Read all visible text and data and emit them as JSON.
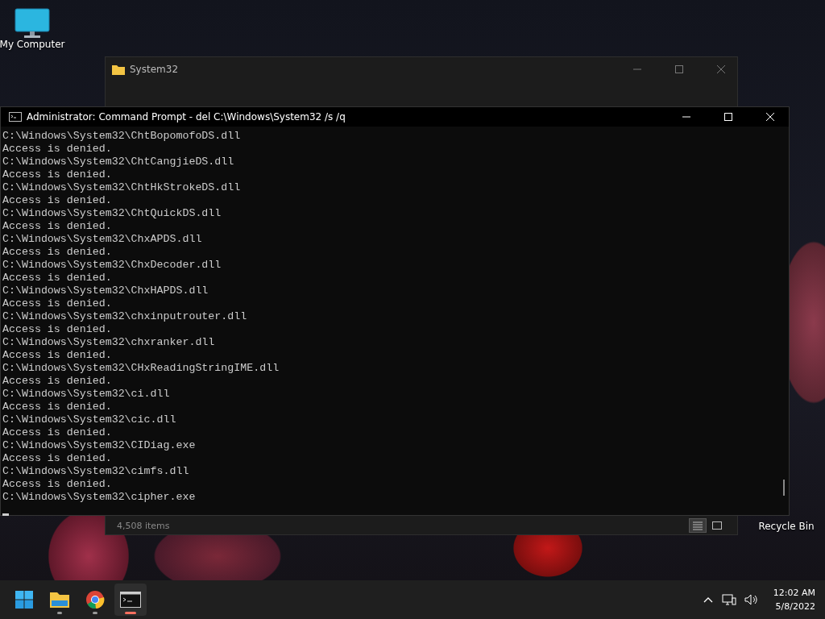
{
  "desktop_icons": [
    {
      "label": "My Computer",
      "kind": "computer"
    },
    {
      "label": "Recycle Bin",
      "kind": "bin"
    }
  ],
  "explorer": {
    "title": "System32",
    "status": "4,508 items",
    "views": [
      {
        "kind": "details",
        "selected": true
      },
      {
        "kind": "tiles",
        "selected": false
      }
    ]
  },
  "console": {
    "title": "Administrator: Command Prompt - del  C:\\Windows\\System32 /s /q",
    "lines": [
      "C:\\Windows\\System32\\ChtBopomofoDS.dll",
      "Access is denied.",
      "C:\\Windows\\System32\\ChtCangjieDS.dll",
      "Access is denied.",
      "C:\\Windows\\System32\\ChtHkStrokeDS.dll",
      "Access is denied.",
      "C:\\Windows\\System32\\ChtQuickDS.dll",
      "Access is denied.",
      "C:\\Windows\\System32\\ChxAPDS.dll",
      "Access is denied.",
      "C:\\Windows\\System32\\ChxDecoder.dll",
      "Access is denied.",
      "C:\\Windows\\System32\\ChxHAPDS.dll",
      "Access is denied.",
      "C:\\Windows\\System32\\chxinputrouter.dll",
      "Access is denied.",
      "C:\\Windows\\System32\\chxranker.dll",
      "Access is denied.",
      "C:\\Windows\\System32\\CHxReadingStringIME.dll",
      "Access is denied.",
      "C:\\Windows\\System32\\ci.dll",
      "Access is denied.",
      "C:\\Windows\\System32\\cic.dll",
      "Access is denied.",
      "C:\\Windows\\System32\\CIDiag.exe",
      "Access is denied.",
      "C:\\Windows\\System32\\cimfs.dll",
      "Access is denied.",
      "C:\\Windows\\System32\\cipher.exe"
    ]
  },
  "taskbar": {
    "apps": [
      {
        "kind": "start",
        "running": false,
        "selected": false
      },
      {
        "kind": "folder",
        "running": true,
        "selected": false
      },
      {
        "kind": "browser",
        "running": true,
        "selected": false
      },
      {
        "kind": "terminal",
        "running": true,
        "selected": true
      }
    ],
    "time": "12:02 AM",
    "date": "5/8/2022"
  }
}
